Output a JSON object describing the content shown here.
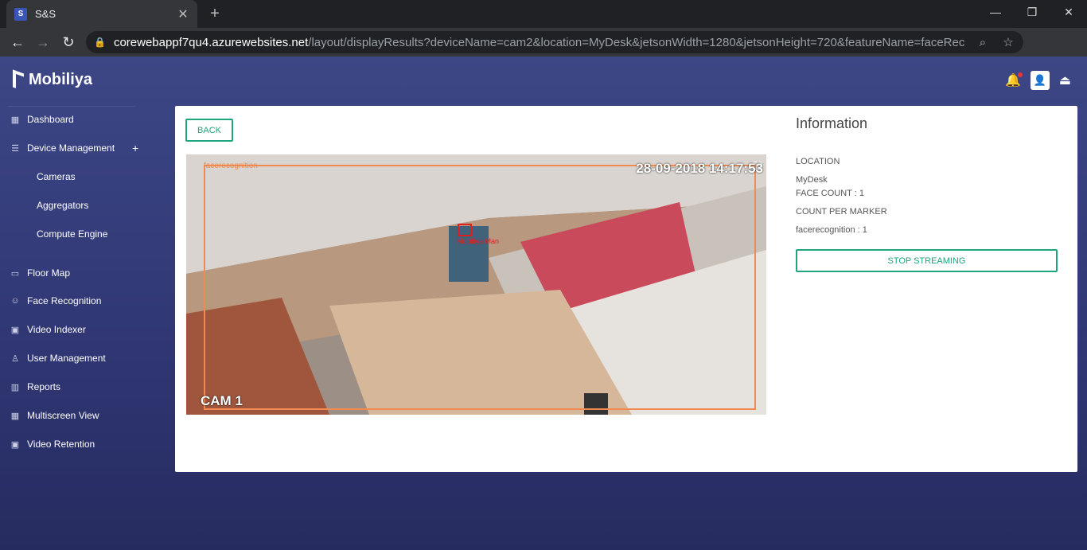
{
  "browser": {
    "tab_title": "S&S",
    "url_host": "corewebappf7qu4.azurewebsites.net",
    "url_path": "/layout/displayResults?deviceName=cam2&location=MyDesk&jetsonWidth=1280&jetsonHeight=720&featureName=faceRecog..."
  },
  "brand": {
    "name": "Mobiliya"
  },
  "sidebar": {
    "items": [
      {
        "label": "Dashboard",
        "icon": "grid-icon"
      },
      {
        "label": "Device Management",
        "icon": "list-icon"
      },
      {
        "label": "Cameras"
      },
      {
        "label": "Aggregators"
      },
      {
        "label": "Compute Engine"
      },
      {
        "label": "Floor Map",
        "icon": "map-icon"
      },
      {
        "label": "Face Recognition",
        "icon": "face-scan-icon"
      },
      {
        "label": "Video Indexer",
        "icon": "film-icon"
      },
      {
        "label": "User Management",
        "icon": "user-icon"
      },
      {
        "label": "Reports",
        "icon": "chart-icon"
      },
      {
        "label": "Multiscreen View",
        "icon": "grid-icon"
      },
      {
        "label": "Video Retention",
        "icon": "film-icon"
      }
    ]
  },
  "main": {
    "back_label": "BACK",
    "video": {
      "overlay_label": "facerecognition",
      "timestamp": "28-09-2018 14:17:53",
      "camera_label": "CAM 1",
      "face_label": "Mobiliya Man"
    },
    "info": {
      "title": "Information",
      "location_label": "LOCATION",
      "location_value": "MyDesk",
      "face_count": "FACE COUNT : 1",
      "count_per_marker_label": "COUNT PER MARKER",
      "marker_value": "facerecognition : 1",
      "stop_label": "STOP STREAMING"
    }
  },
  "colors": {
    "accent": "#1ea57d",
    "box": "#f08a50",
    "face_box": "#e02020"
  }
}
